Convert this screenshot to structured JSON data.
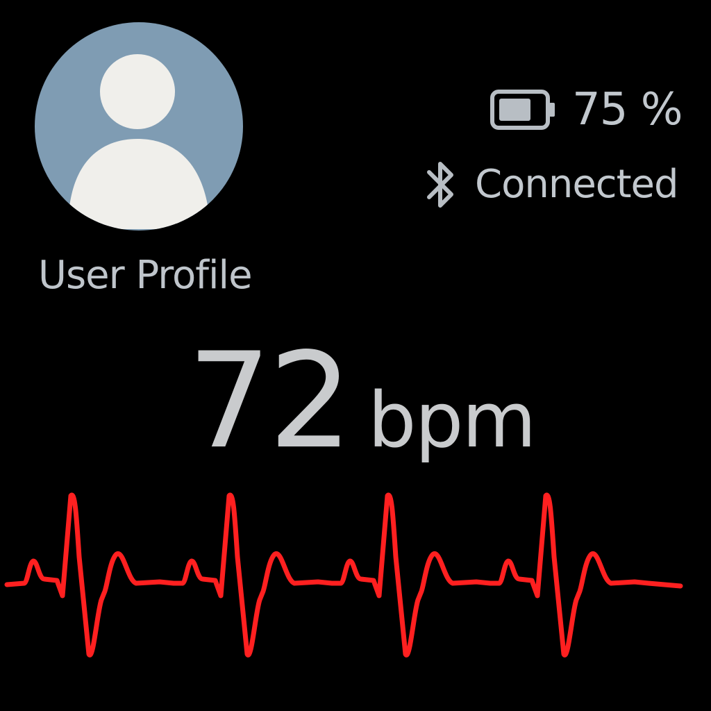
{
  "profile": {
    "avatar_icon": "user-avatar-icon",
    "label": "User Profile",
    "avatar_bg": "#7f9cb3",
    "avatar_fg": "#f0efeb"
  },
  "status": {
    "battery_icon": "battery-icon",
    "battery_level": 0.75,
    "battery_text": "75 %",
    "bluetooth_icon": "bluetooth-icon",
    "connection_text": "Connected"
  },
  "heart_rate": {
    "value": "72",
    "unit": "bpm"
  },
  "waveform": {
    "icon": "ecg-waveform",
    "color": "#ff2020",
    "beats": 4
  }
}
